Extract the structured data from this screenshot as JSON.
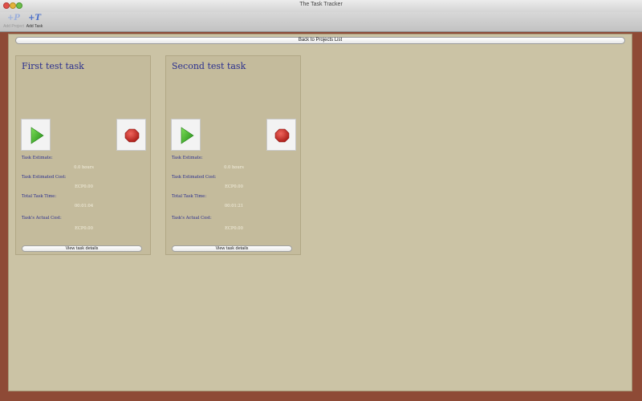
{
  "window": {
    "title": "The Task Tracker"
  },
  "toolbar": {
    "add_project": {
      "label": "Add Project",
      "icon": "add-project-icon",
      "glyph": "+P"
    },
    "add_task": {
      "label": "Add Task",
      "icon": "add-task-icon",
      "glyph": "+T"
    }
  },
  "back_button": {
    "label": "Back to Projects List"
  },
  "field_labels": {
    "estimate": "Task Estimate:",
    "estimated_cost": "Task Estimated Cost:",
    "total_time": "Total Task Time:",
    "actual_cost": "Task's Actual Cost:"
  },
  "tasks": [
    {
      "title": "First test task",
      "estimate": "0.0 hours",
      "estimated_cost": "ECP0.00",
      "total_time": "00:01:04",
      "actual_cost": "ECP0.00",
      "details_label": "View task details"
    },
    {
      "title": "Second test task",
      "estimate": "0.0 hours",
      "estimated_cost": "ECP0.00",
      "total_time": "00:01:21",
      "actual_cost": "ECP0.00",
      "details_label": "View task details"
    }
  ],
  "colors": {
    "accent_text": "#2a2f8f",
    "play_green": "#2fa51f",
    "stop_red": "#c8302a",
    "background": "#cbc3a5",
    "frame": "#8e4a36"
  }
}
